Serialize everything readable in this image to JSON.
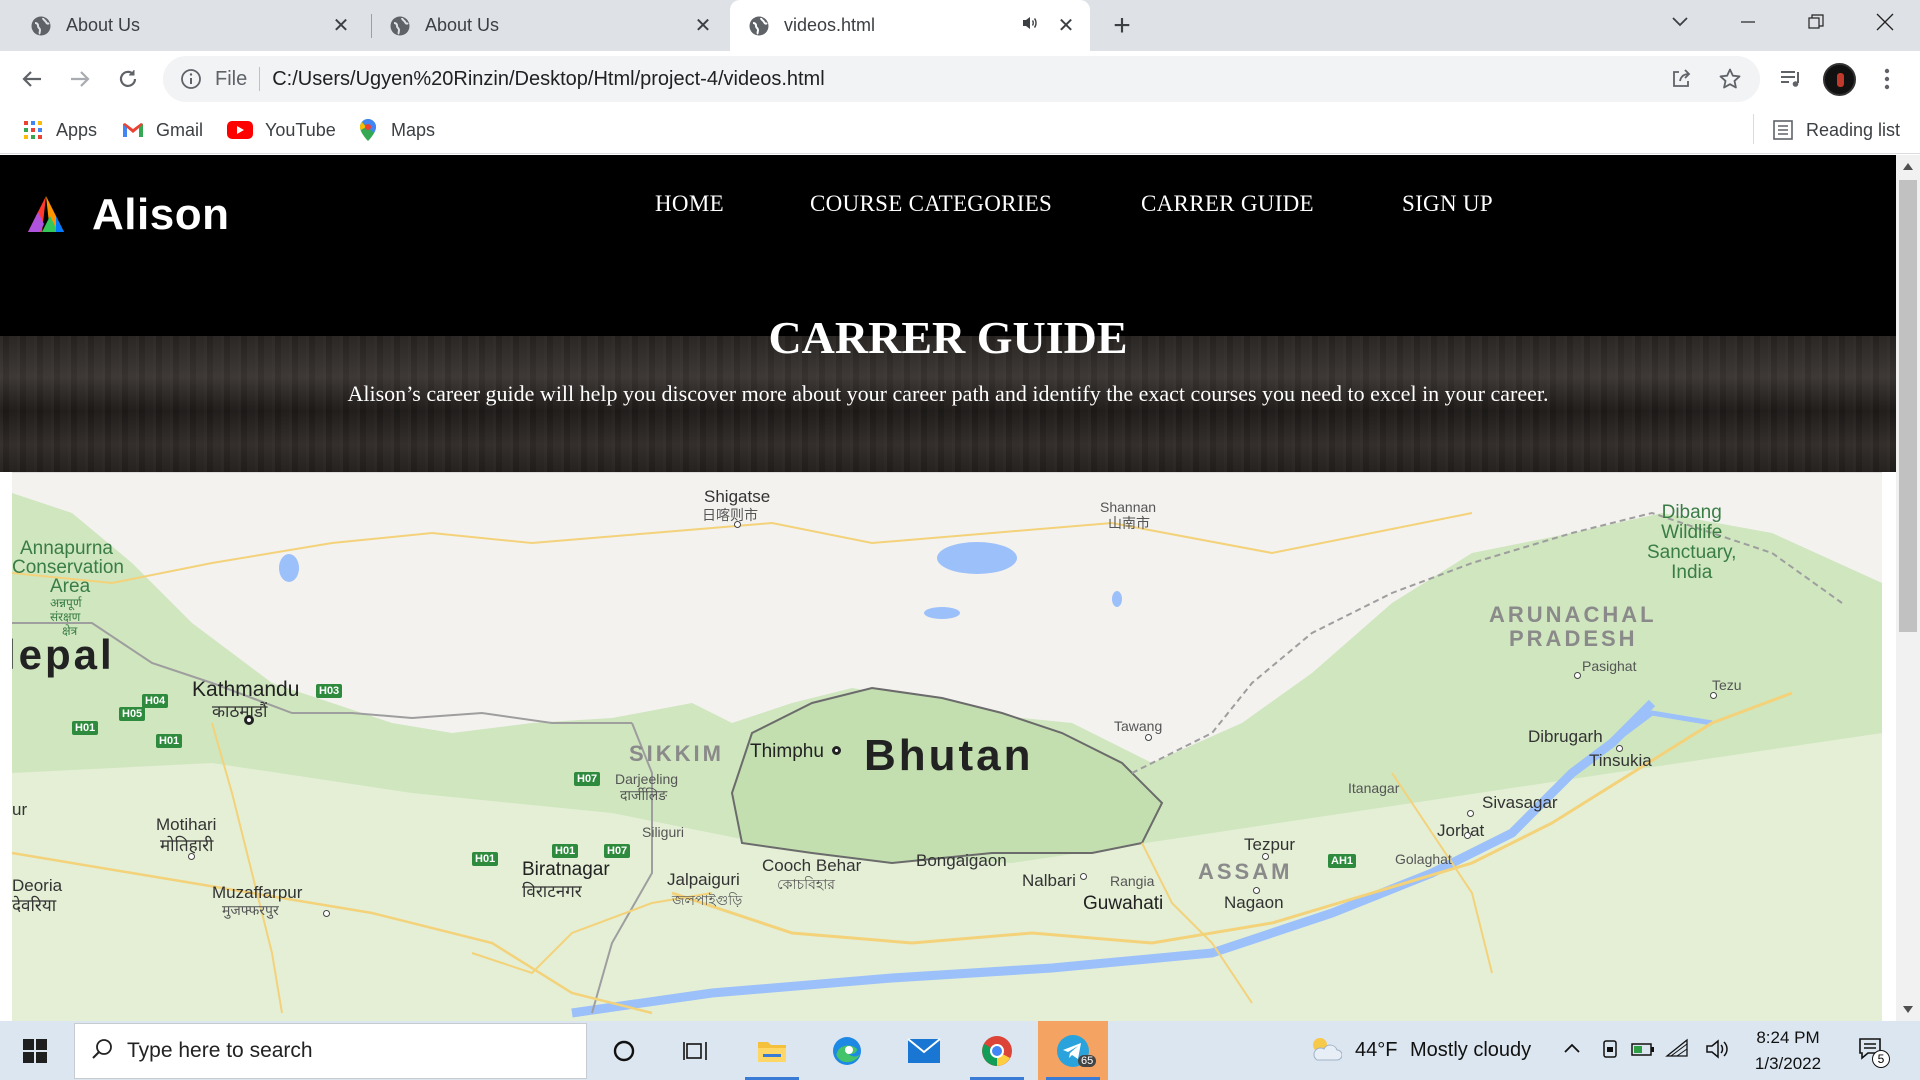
{
  "browser": {
    "tabs": [
      {
        "title": "About Us",
        "active": false
      },
      {
        "title": "About Us",
        "active": false
      },
      {
        "title": "videos.html",
        "active": true,
        "audio": true
      }
    ],
    "address": {
      "scheme": "File",
      "url": "C:/Users/Ugyen%20Rinzin/Desktop/Html/project-4/videos.html"
    },
    "bookmarks": [
      {
        "label": "Apps",
        "icon": "apps-grid-icon"
      },
      {
        "label": "Gmail",
        "icon": "gmail-icon"
      },
      {
        "label": "YouTube",
        "icon": "youtube-icon"
      },
      {
        "label": "Maps",
        "icon": "maps-pin-icon"
      }
    ],
    "reading_list": "Reading list"
  },
  "site": {
    "logo_text": "Alison",
    "nav": [
      "HOME",
      "COURSE CATEGORIES",
      "CARRER GUIDE",
      "SIGN UP"
    ],
    "hero_title": "CARRER GUIDE",
    "hero_subtitle": "Alison’s career guide will help you discover more about your career path and identify the exact courses you need to excel in your career."
  },
  "map": {
    "country": "Bhutan",
    "labels": {
      "shigatse": "Shigatse",
      "shigatse_cn": "日喀则市",
      "shannan": "Shannan",
      "shannan_cn": "山南市",
      "dibang": [
        "Dibang",
        "Wildlife",
        "Sanctuary,",
        "India"
      ],
      "annapurna": [
        "Annapurna",
        "Conservation",
        "Area",
        "अन्नपूर्ण",
        "संरक्षण",
        "क्षेत्र"
      ],
      "arunachal": [
        "ARUNACHAL",
        "PRADESH"
      ],
      "nepal": "lepal",
      "kathmandu": "Kathmandu",
      "kathmandu_ne": "काठमाडौं",
      "pasighat": "Pasighat",
      "tezu": "Tezu",
      "tawang": "Tawang",
      "sikkim": "SIKKIM",
      "thimphu": "Thimphu",
      "dibrugarh": "Dibrugarh",
      "tinsukia": "Tinsukia",
      "darjeeling": "Darjeeling",
      "darjeeling_hi": "दार्जीलिङ",
      "itanagar": "Itanagar",
      "sivasagar": "Sivasagar",
      "ur": "ur",
      "motihari": "Motihari",
      "motihari_hi": "मोतिहारी",
      "siliguri": "Siliguri",
      "jorhat": "Jorhat",
      "tezpur": "Tezpur",
      "golaghat": "Golaghat",
      "biratnagar": "Biratnagar",
      "biratnagar_ne": "विराटनगर",
      "coochbehar": "Cooch Behar",
      "coochbehar_bn": "কোচবিহার",
      "bongaigaon": "Bongaigaon",
      "assam": "ASSAM",
      "jalpaiguri": "Jalpaiguri",
      "jalpaiguri_bn": "জলপাইগুড়ি",
      "nalbari": "Nalbari",
      "rangia": "Rangia",
      "deoria": "Deoria",
      "deoria_hi": "देवरिया",
      "muzaffarpur": "Muzaffarpur",
      "muzaffarpur_hi": "मुजफ्फरपुर",
      "guwahati": "Guwahati",
      "nagaon": "Nagaon"
    },
    "highways": [
      "H04",
      "H03",
      "H05",
      "H01",
      "H01",
      "H07",
      "H01",
      "H07",
      "H01",
      "AH1"
    ]
  },
  "taskbar": {
    "search_placeholder": "Type here to search",
    "weather_temp": "44°F",
    "weather_text": "Mostly cloudy",
    "time": "8:24 PM",
    "date": "1/3/2022",
    "notification_count": "5",
    "telegram_badge": "65"
  }
}
